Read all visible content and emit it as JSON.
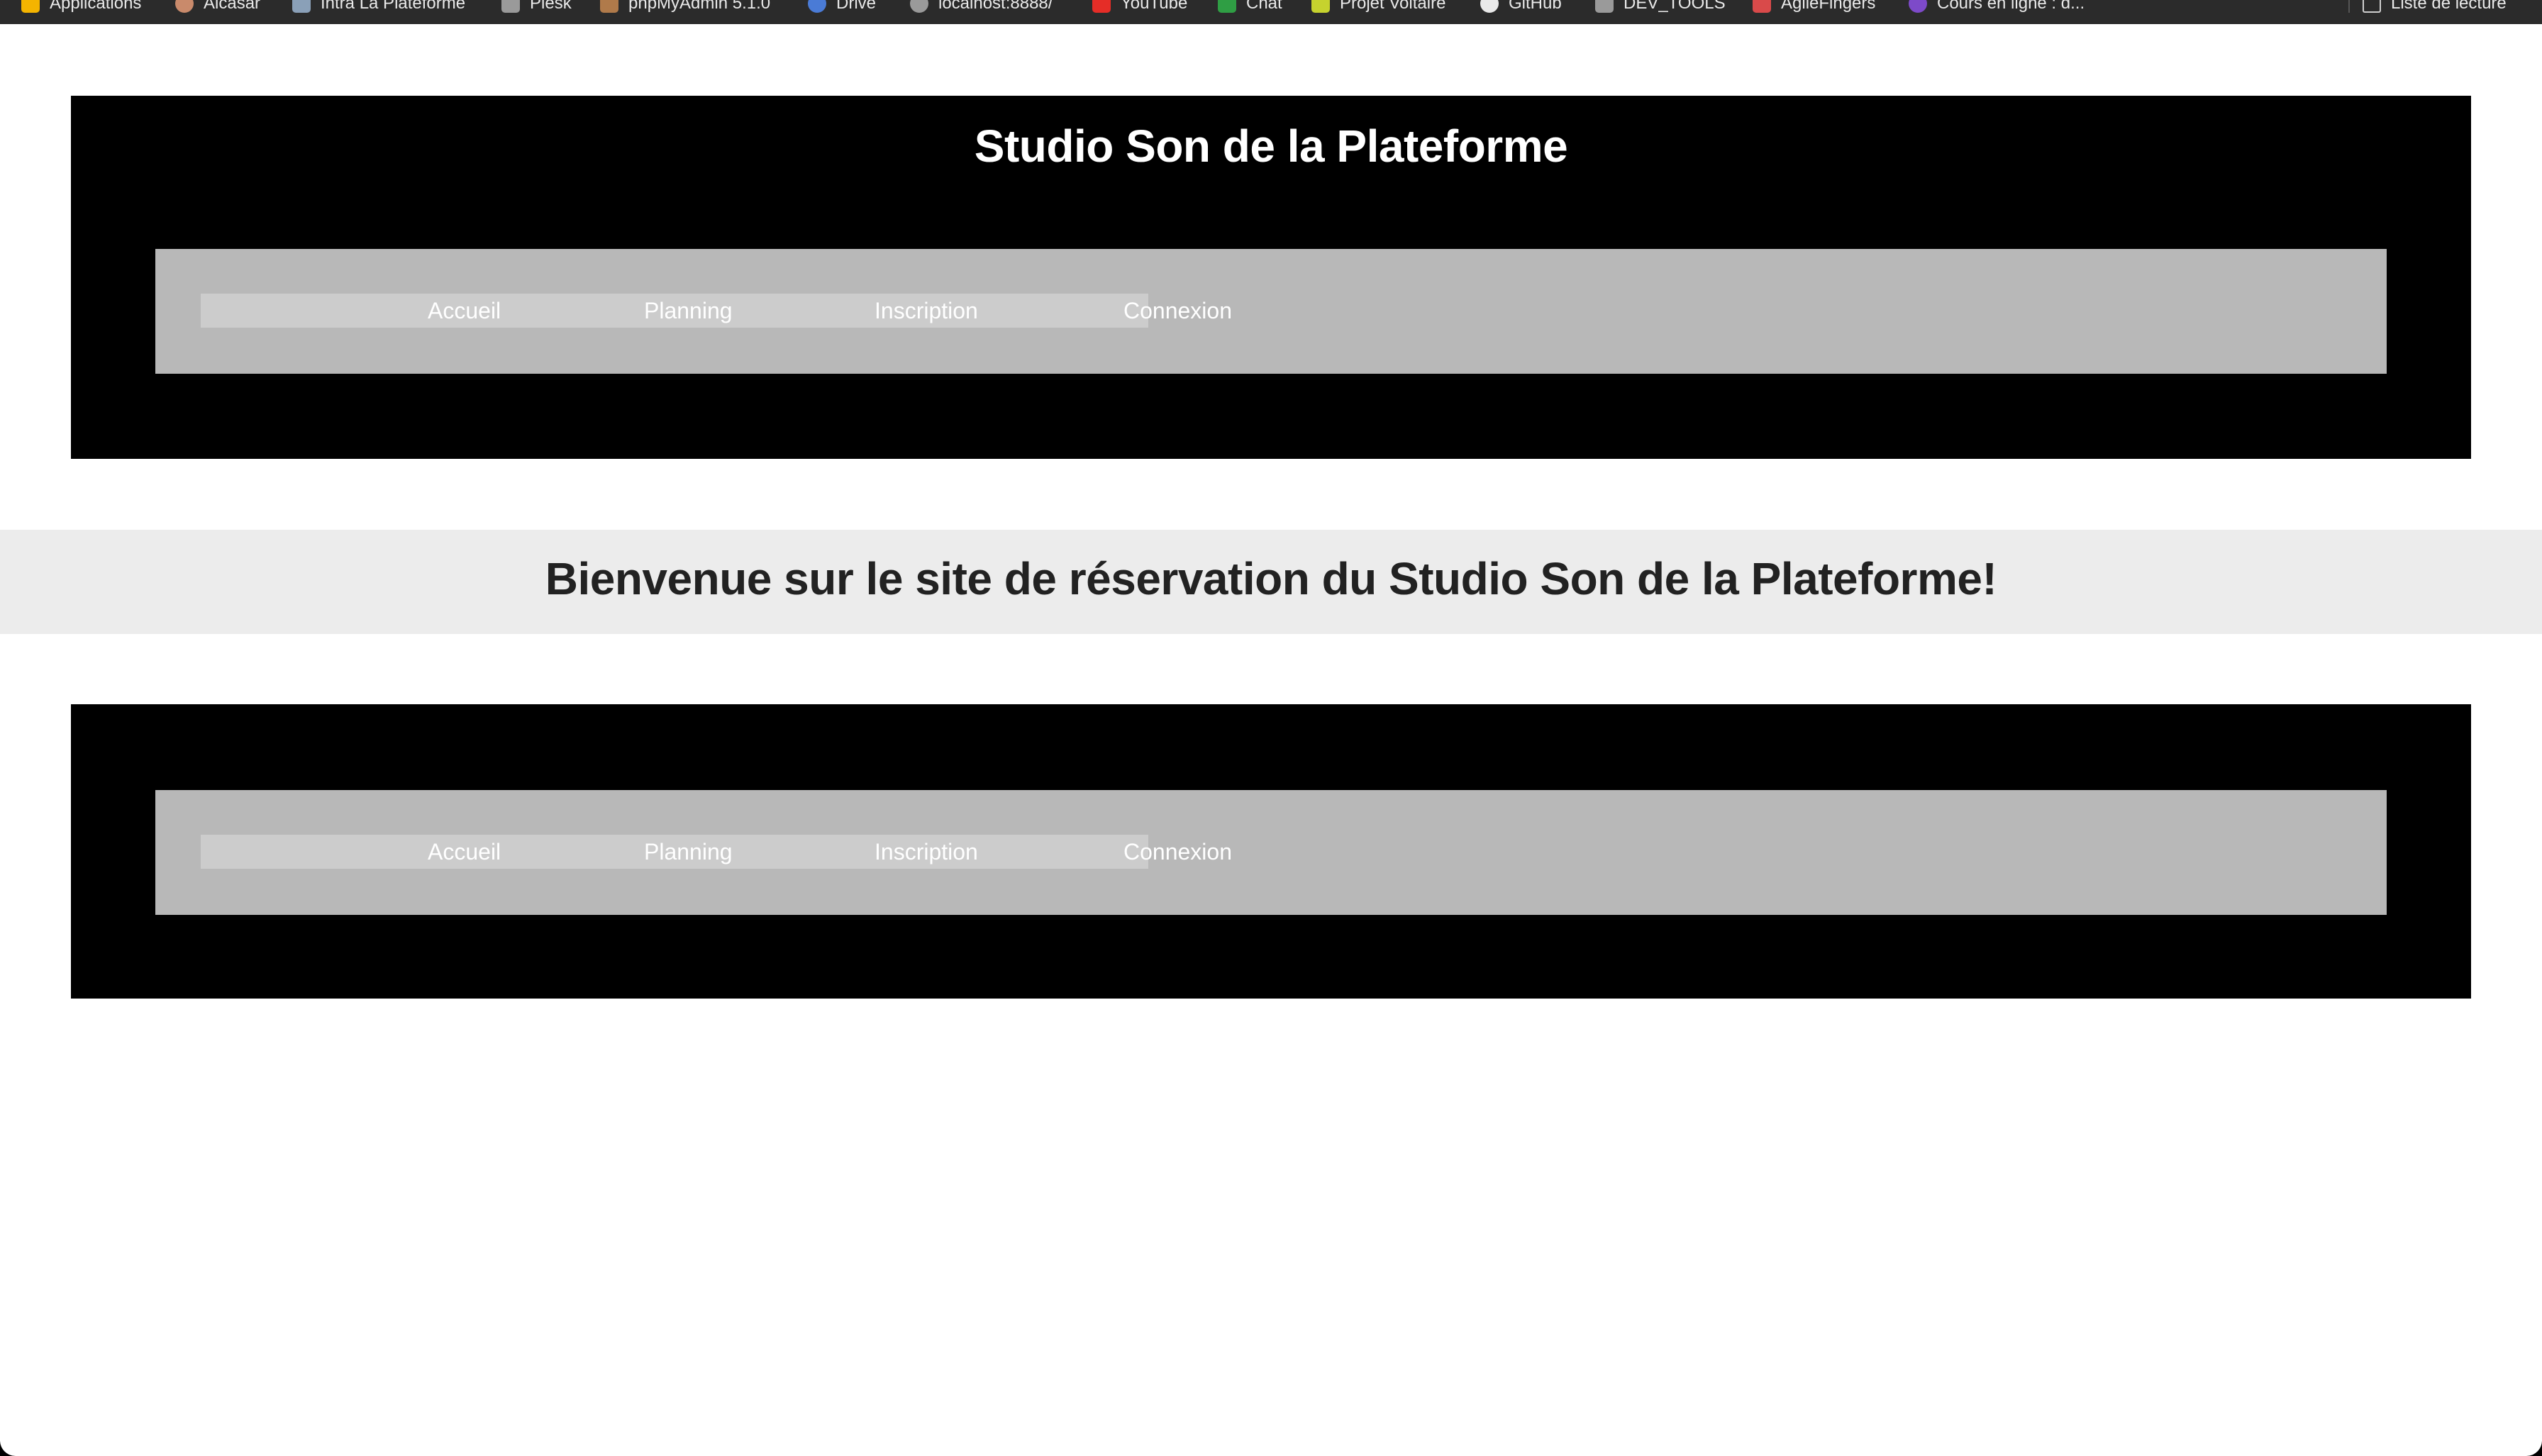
{
  "bookmarks": [
    {
      "label": "Applications",
      "icon": "apps-grid-icon",
      "color": "#f4b400"
    },
    {
      "label": "Alcasar",
      "icon": "alcasar-icon",
      "color": "#c98a6b"
    },
    {
      "label": "Intra La Plateforme",
      "icon": "page-icon",
      "color": "#8aa0b8"
    },
    {
      "label": "Plesk",
      "icon": "folder-icon",
      "color": "#9a9a9a"
    },
    {
      "label": "phpMyAdmin 5.1.0",
      "icon": "phpmyadmin-icon",
      "color": "#b07a4a"
    },
    {
      "label": "Drive",
      "icon": "drive-icon",
      "color": "#4a7bd6"
    },
    {
      "label": "localhost:8888/",
      "icon": "globe-icon",
      "color": "#9a9a9a"
    },
    {
      "label": "YouTube",
      "icon": "youtube-icon",
      "color": "#e52d27"
    },
    {
      "label": "Chat",
      "icon": "chat-icon",
      "color": "#2f9e44"
    },
    {
      "label": "Projet Voltaire",
      "icon": "voltaire-icon",
      "color": "#c6d22e"
    },
    {
      "label": "GitHub",
      "icon": "github-icon",
      "color": "#e9e9e9"
    },
    {
      "label": "DEV_TOOLS",
      "icon": "folder-icon",
      "color": "#9a9a9a"
    },
    {
      "label": "AgileFingers",
      "icon": "agilefingers-icon",
      "color": "#d94a4a"
    },
    {
      "label": "Cours en ligne : d...",
      "icon": "course-icon",
      "color": "#7d4ac9"
    }
  ],
  "reading_list": {
    "label": "Liste de lecture",
    "icon": "reading-list-icon"
  },
  "header": {
    "title": "Studio Son de la Plateforme"
  },
  "nav": {
    "items": [
      {
        "label": "Accueil"
      },
      {
        "label": "Planning"
      },
      {
        "label": "Inscription"
      },
      {
        "label": "Connexion"
      }
    ]
  },
  "main": {
    "welcome": "Bienvenue sur le site de réservation du Studio Son de la Plateforme!"
  },
  "colors": {
    "header_bg": "#000000",
    "nav_panel_bg": "#b8b8b8",
    "nav_list_bg": "#cccccc",
    "welcome_band_bg": "#ececec",
    "text_light": "#ffffff",
    "text_dark": "#222222"
  }
}
